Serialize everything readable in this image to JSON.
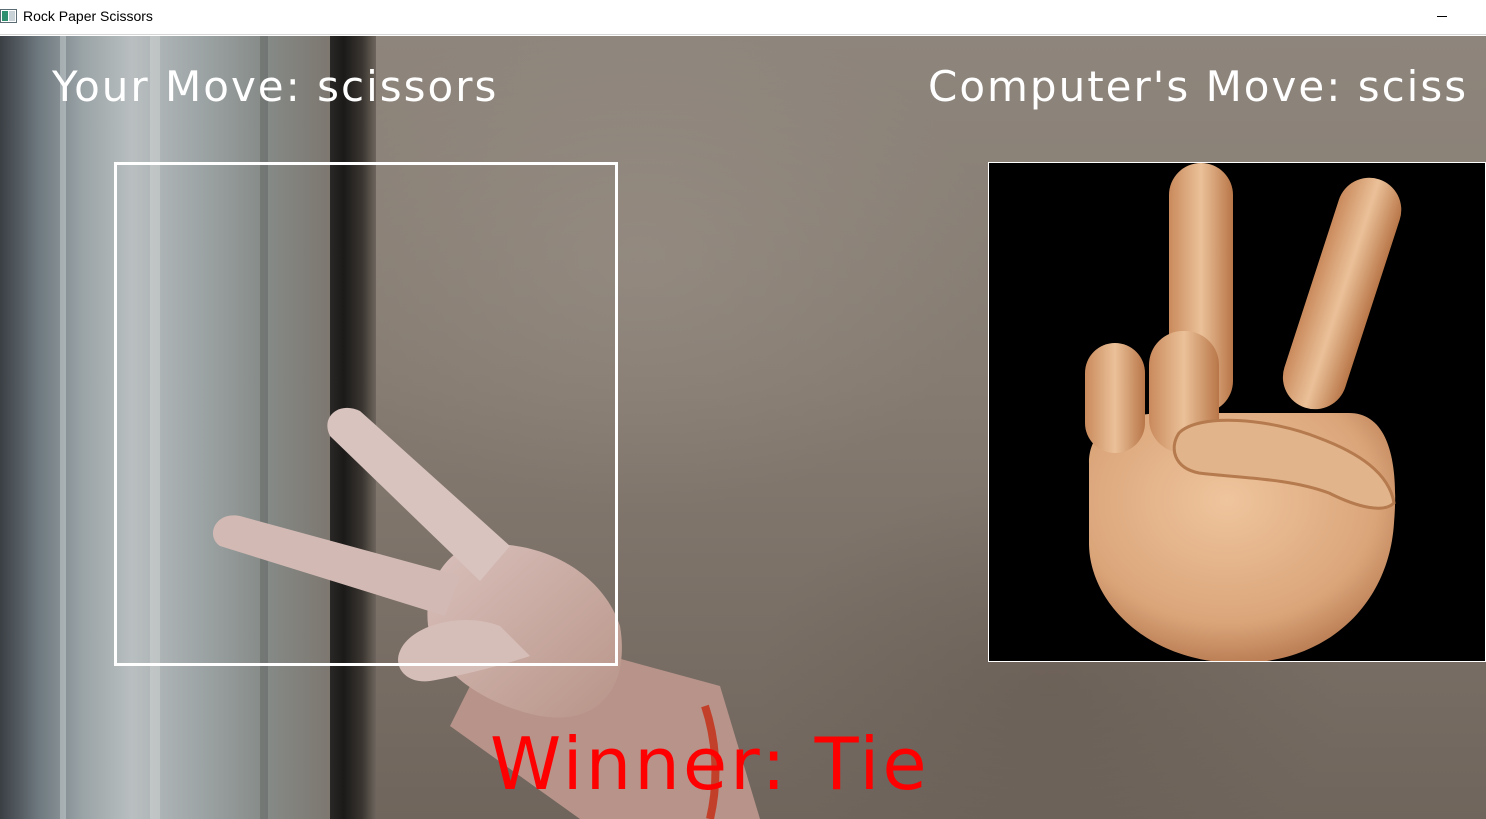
{
  "window": {
    "title": "Rock Paper Scissors"
  },
  "game": {
    "user_move_text": "Your Move: scissors",
    "computer_move_text": "Computer's Move: sciss",
    "winner_text": "Winner: Tie"
  },
  "colors": {
    "overlay_text": "#ffffff",
    "winner_text": "#ff0000",
    "roi_border": "#ffffff",
    "computer_panel_bg": "#000000"
  },
  "icons": {
    "app": "app-icon",
    "user_hand": "peace-hand-photo",
    "computer_hand": "victory-hand-emoji-icon"
  }
}
